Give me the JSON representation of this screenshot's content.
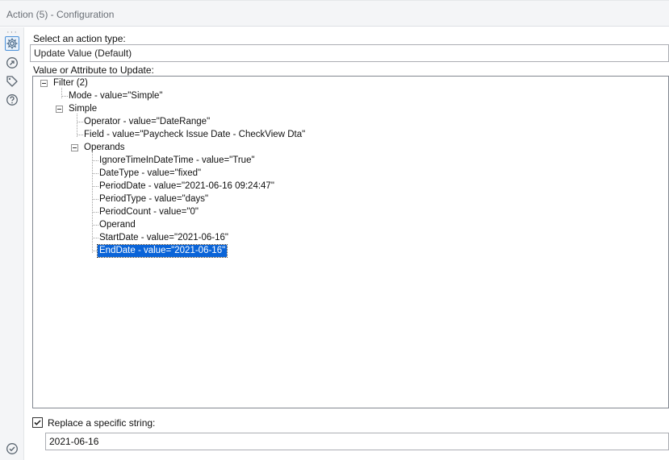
{
  "window": {
    "title": "Action (5) - Configuration"
  },
  "sidebar": {
    "dots": "···",
    "icons": [
      "gear-icon",
      "connection-icon",
      "tag-icon",
      "help-icon",
      "check-circle-icon"
    ]
  },
  "action_type": {
    "label": "Select an action type:",
    "selected": "Update Value (Default)"
  },
  "value_section": {
    "label": "Value or Attribute to Update:"
  },
  "tree": {
    "filter": "Filter (2)",
    "mode": "Mode - value=\"Simple\"",
    "simple": "Simple",
    "operator": "Operator - value=\"DateRange\"",
    "field": "Field - value=\"Paycheck Issue Date - CheckView Dta\"",
    "operands": "Operands",
    "ignore_time": "IgnoreTimeInDateTime - value=\"True\"",
    "date_type": "DateType - value=\"fixed\"",
    "period_date": "PeriodDate - value=\"2021-06-16 09:24:47\"",
    "period_type": "PeriodType - value=\"days\"",
    "period_count": "PeriodCount - value=\"0\"",
    "operand": "Operand",
    "start_date": "StartDate - value=\"2021-06-16\"",
    "end_date": "EndDate - value=\"2021-06-16\""
  },
  "replace": {
    "label": "Replace a specific string:",
    "checked": true,
    "value": "2021-06-16"
  },
  "colors": {
    "accent": "#0a64d8",
    "border": "#abadb3"
  }
}
